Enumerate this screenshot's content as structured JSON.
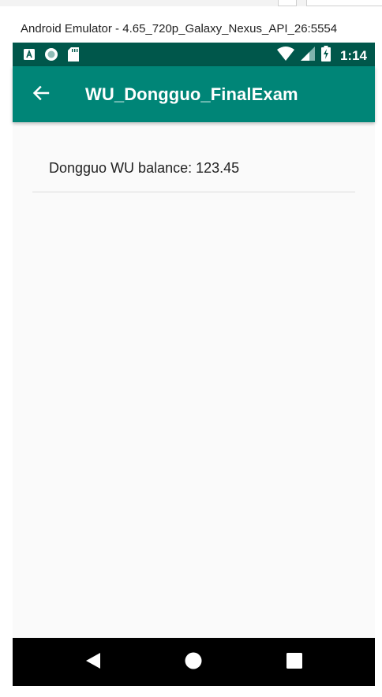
{
  "window": {
    "title": "Android Emulator - 4.65_720p_Galaxy_Nexus_API_26:5554"
  },
  "status_bar": {
    "time": "1:14",
    "icons_left": [
      "app-a-icon",
      "circle-icon",
      "sd-card-icon"
    ],
    "icons_right": [
      "wifi-icon",
      "cell-signal-icon",
      "battery-charging-icon"
    ]
  },
  "app_bar": {
    "title": "WU_Dongguo_FinalExam",
    "back_icon": "arrow-back-icon",
    "color": "#008577",
    "status_color": "#00574b"
  },
  "list": {
    "items": [
      {
        "text": "Dongguo WU balance: 123.45"
      }
    ]
  },
  "nav_bar": {
    "buttons": [
      "back-triangle-icon",
      "home-circle-icon",
      "recents-square-icon"
    ]
  }
}
